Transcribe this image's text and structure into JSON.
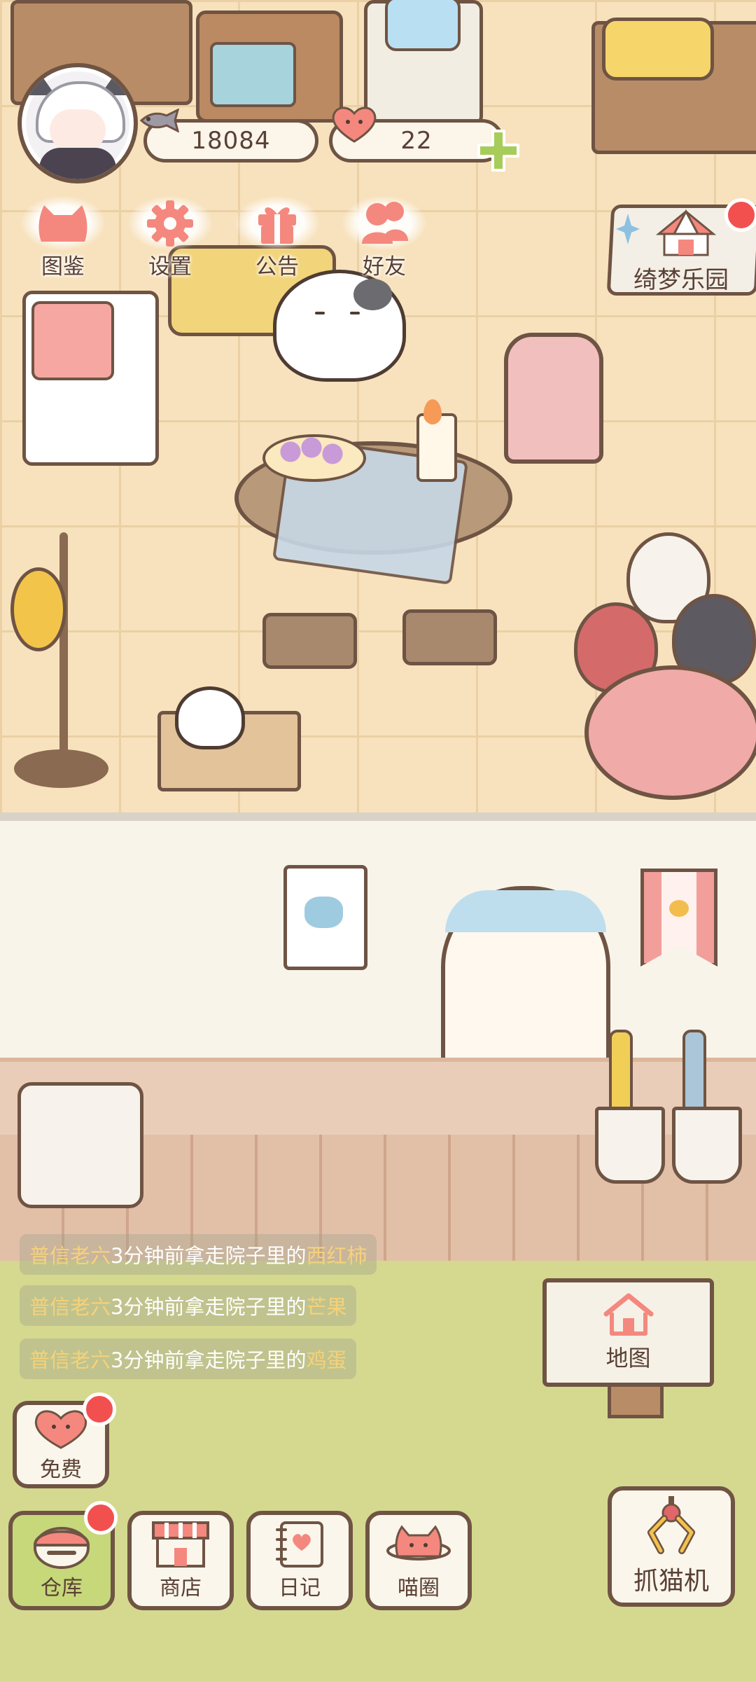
{
  "hud": {
    "fish_count": "18084",
    "heart_count": "22"
  },
  "top_menu": [
    {
      "label": "图鉴",
      "icon": "cat-head-icon"
    },
    {
      "label": "设置",
      "icon": "gear-icon"
    },
    {
      "label": "公告",
      "icon": "gift-icon"
    },
    {
      "label": "好友",
      "icon": "friends-icon"
    }
  ],
  "park": {
    "label": "绮梦乐园",
    "icon": "circus-tent-icon",
    "has_notification": true
  },
  "feed": [
    {
      "actor": "普信老六",
      "text": "3分钟前拿走院子里的",
      "item": "西红柿"
    },
    {
      "actor": "普信老六",
      "text": "3分钟前拿走院子里的",
      "item": "芒果"
    },
    {
      "actor": "普信老六",
      "text": "3分钟前拿走院子里的",
      "item": "鸡蛋"
    }
  ],
  "map": {
    "label": "地图",
    "icon": "house-icon"
  },
  "free": {
    "label": "免费",
    "icon": "heart-icon",
    "has_notification": true
  },
  "bottom_nav": [
    {
      "label": "仓库",
      "icon": "storage-icon",
      "has_notification": true,
      "active": true
    },
    {
      "label": "商店",
      "icon": "shop-icon",
      "has_notification": false,
      "active": false
    },
    {
      "label": "日记",
      "icon": "diary-icon",
      "has_notification": false,
      "active": false
    },
    {
      "label": "喵圈",
      "icon": "cat-planet-icon",
      "has_notification": false,
      "active": false
    }
  ],
  "claw_machine": {
    "label": "抓猫机",
    "icon": "claw-icon"
  },
  "colors": {
    "outline": "#6f5444",
    "accent_pink": "#f4887e",
    "notify_red": "#f2504f",
    "grass": "#d4d98f",
    "floor": "#f7e2bd"
  }
}
